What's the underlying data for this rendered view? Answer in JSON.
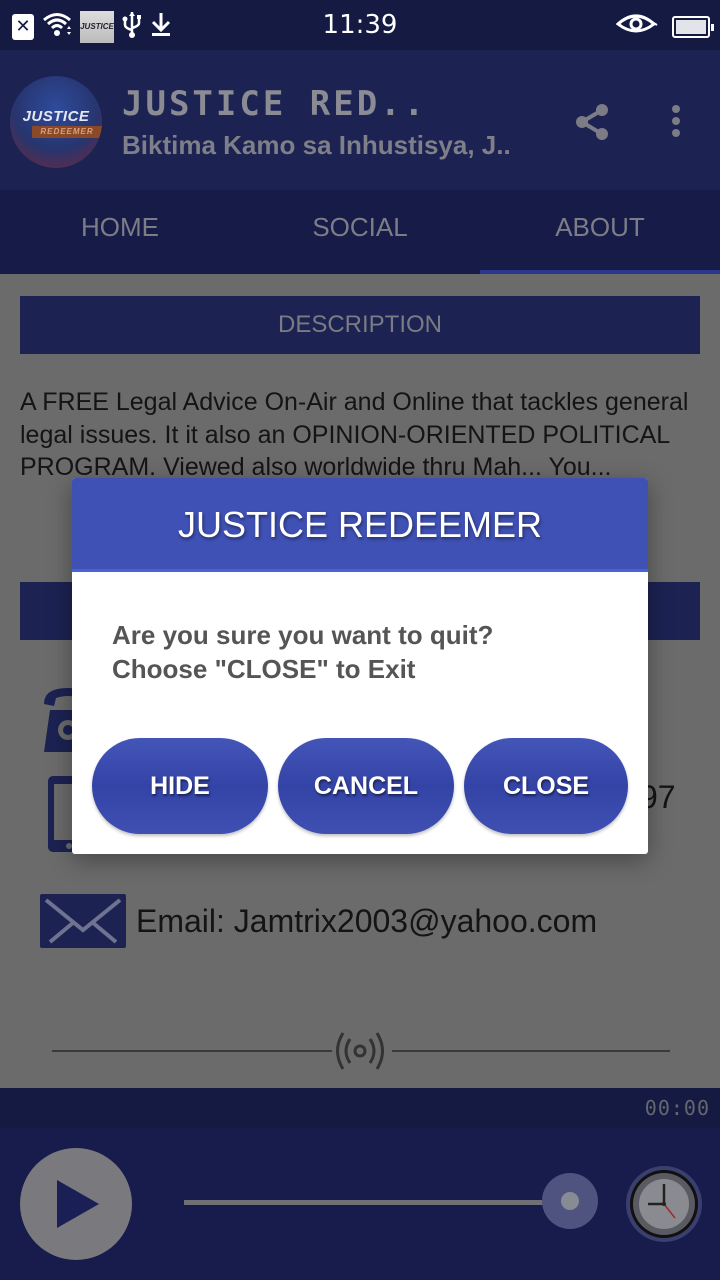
{
  "status_bar": {
    "time": "11:39",
    "left_icons": [
      "close-notification-icon",
      "wifi-icon",
      "app-thumbnail-icon",
      "usb-icon",
      "download-icon"
    ],
    "thumbnail_label": "JUSTICE",
    "right_icons": [
      "eye-icon",
      "battery-icon"
    ]
  },
  "app_bar": {
    "logo_line1": "JUSTICE",
    "logo_line2": "REDEEMER",
    "title": "JUSTICE RED..",
    "subtitle": "Biktima Kamo sa Inhustisya, J..",
    "actions": [
      "share-icon",
      "more-options-icon"
    ]
  },
  "tabs": [
    {
      "label": "HOME",
      "active": false
    },
    {
      "label": "SOCIAL",
      "active": false
    },
    {
      "label": "ABOUT",
      "active": true
    }
  ],
  "content": {
    "description_header": "DESCRIPTION",
    "description_text": "A FREE Legal Advice On-Air and Online that tackles general legal issues. It it also an OPINION-ORIENTED POLITICAL PROGRAM. Viewed also worldwide thru Mah... You...",
    "contact_header": "",
    "phone_number_fragment": "97",
    "email": "Email: Jamtrix2003@yahoo.com"
  },
  "player": {
    "elapsed": "00:00",
    "progress": 1.0
  },
  "dialog": {
    "title": "JUSTICE REDEEMER",
    "message_line1": "Are you sure you want to quit?",
    "message_line2": "Choose \"CLOSE\" to Exit",
    "buttons": {
      "hide": "HIDE",
      "cancel": "CANCEL",
      "close": "CLOSE"
    }
  },
  "colors": {
    "primary": "#3f51b5",
    "app_bar_dimmed": "#1c2252",
    "status_bar": "#141a42"
  }
}
